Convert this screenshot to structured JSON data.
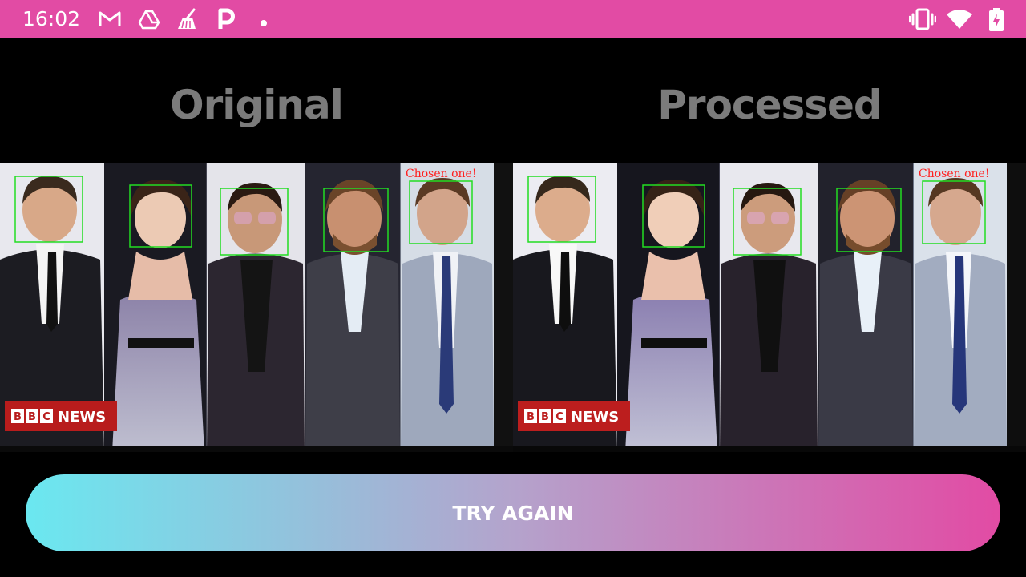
{
  "status_bar": {
    "time": "16:02",
    "bg_color": "#e24ba4",
    "left_icons": [
      "gmail-icon",
      "drive-icon",
      "cleaner-icon",
      "p-app-icon",
      "dot-icon"
    ],
    "right_icons": [
      "vibrate-icon",
      "wifi-icon",
      "battery-charging-icon"
    ]
  },
  "panels": [
    {
      "title": "Original"
    },
    {
      "title": "Processed"
    }
  ],
  "photo": {
    "overlay_text": "Chosen one!",
    "badge_bbc": "BBC",
    "badge_news": "NEWS",
    "box_color": "#22dd22",
    "label_color": "#ff2020"
  },
  "try_again": {
    "label": "TRY AGAIN",
    "gradient_start": "#6ae8f0",
    "gradient_end": "#e24ba4"
  }
}
